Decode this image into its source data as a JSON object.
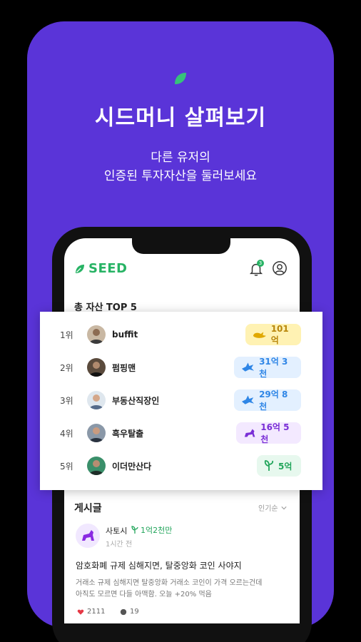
{
  "promo": {
    "headline": "시드머니 살펴보기",
    "subline1": "다른 유저의",
    "subline2": "인증된 투자자산을 둘러보세요",
    "leaf_icon": "leaf-icon",
    "brand_color": "#5a34d8"
  },
  "app": {
    "logo_text": "SEED",
    "logo_icon": "leaf-icon",
    "bell_icon": "bell-icon",
    "bell_badge": "3",
    "profile_icon": "user-circle-icon",
    "accent_color": "#27b364"
  },
  "ranking": {
    "title": "총 자산 TOP 5",
    "rows": [
      {
        "rank": "1위",
        "name": "buffit",
        "amount": "101억",
        "tier_icon": "whale-icon",
        "tier": "gold"
      },
      {
        "rank": "2위",
        "name": "펌핑맨",
        "amount": "31억 3천",
        "tier_icon": "shark-icon",
        "tier": "blue"
      },
      {
        "rank": "3위",
        "name": "부동산직장인",
        "amount": "29억 8천",
        "tier_icon": "shark-icon",
        "tier": "blue"
      },
      {
        "rank": "4위",
        "name": "흑우탈출",
        "amount": "16억 5천",
        "tier_icon": "dog-icon",
        "tier": "purple"
      },
      {
        "rank": "5위",
        "name": "이더만산다",
        "amount": "5억",
        "tier_icon": "sprout-icon",
        "tier": "green"
      }
    ]
  },
  "posts": {
    "title": "게시글",
    "sort_label": "인기순",
    "item": {
      "user": "사토시",
      "asset": "1억2천만",
      "time": "1시간 전",
      "headline": "암호화폐 규제 심해지면, 탈중앙화 코인 사야지",
      "body_line1": "거래소 규제 심해지면 탈중앙화 거래소 코인이 가격 오르는건데",
      "body_line2": "아직도 모르면 다들 아맥함. 오늘 +20% 먹음",
      "likes": "2111",
      "comments": "19"
    }
  }
}
